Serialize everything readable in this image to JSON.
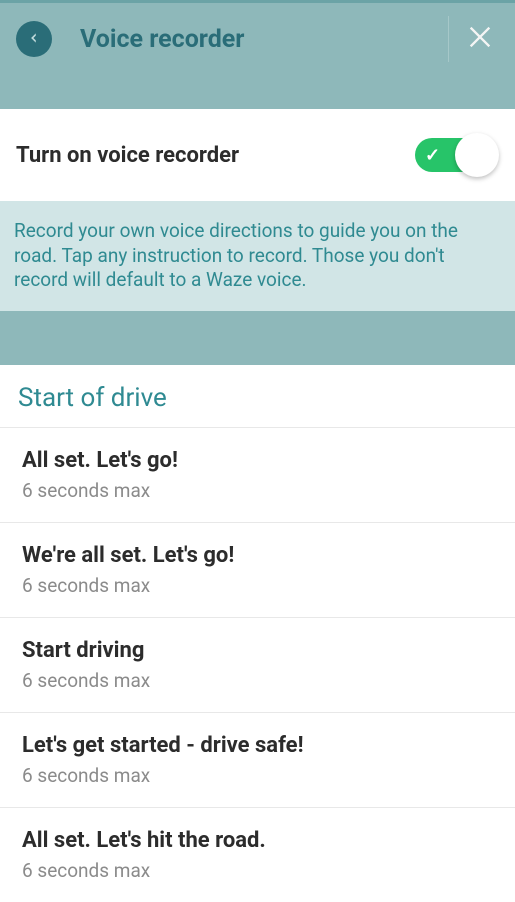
{
  "header": {
    "title": "Voice recorder"
  },
  "toggle": {
    "label": "Turn on voice recorder",
    "enabled": true
  },
  "info": {
    "text": "Record your own voice directions to guide you on the road. Tap any instruction to record. Those you don't record will default to a Waze voice."
  },
  "section": {
    "title": "Start of drive",
    "items": [
      {
        "title": "All set. Let's go!",
        "sub": "6 seconds max"
      },
      {
        "title": "We're all set. Let's go!",
        "sub": "6 seconds max"
      },
      {
        "title": "Start driving",
        "sub": "6 seconds max"
      },
      {
        "title": "Let's get started - drive safe!",
        "sub": "6 seconds max"
      },
      {
        "title": "All set. Let's hit the road.",
        "sub": "6 seconds max"
      }
    ]
  }
}
